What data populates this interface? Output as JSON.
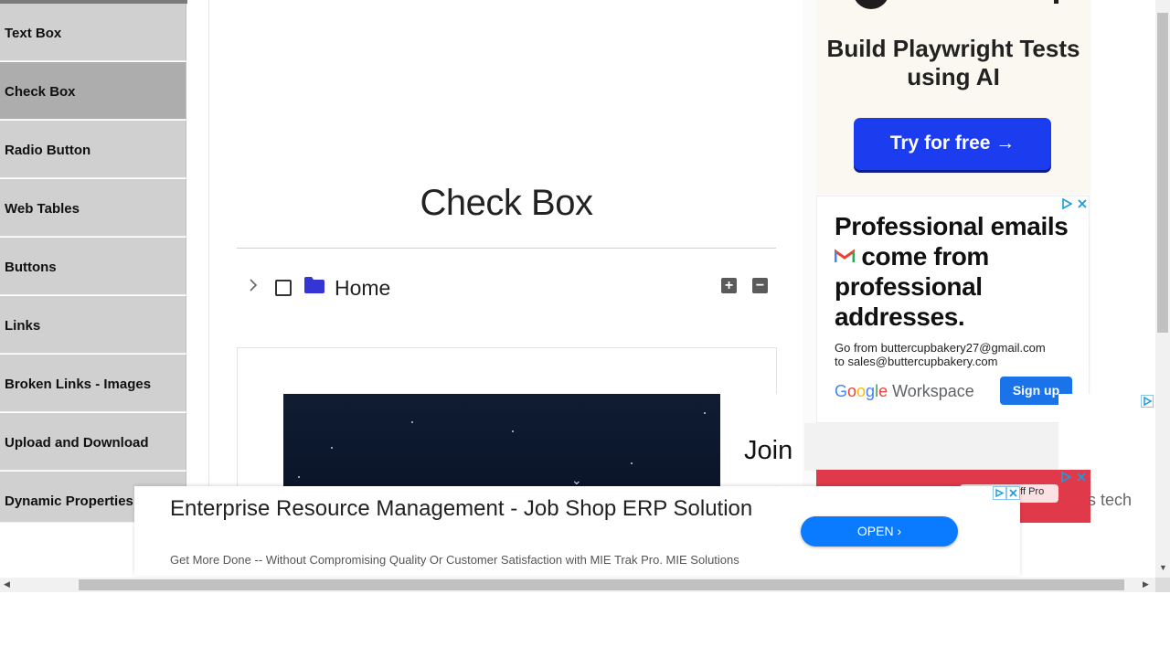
{
  "sidebar": {
    "items": [
      {
        "label": "Text Box",
        "active": false
      },
      {
        "label": "Check Box",
        "active": true
      },
      {
        "label": "Radio Button",
        "active": false
      },
      {
        "label": "Web Tables",
        "active": false
      },
      {
        "label": "Buttons",
        "active": false
      },
      {
        "label": "Links",
        "active": false
      },
      {
        "label": "Broken Links - Images",
        "active": false
      },
      {
        "label": "Upload and Download",
        "active": false
      },
      {
        "label": "Dynamic Properties",
        "active": false
      }
    ]
  },
  "main": {
    "title": "Check Box",
    "tree": {
      "root_label": "Home",
      "checked": false,
      "expanded": false,
      "expand_all_symbol": "+",
      "collapse_all_symbol": "−"
    },
    "video_ad": {
      "side_text": "Join"
    }
  },
  "ads": {
    "playwright": {
      "title": "Build Playwright Tests using AI",
      "cta": "Try for free →"
    },
    "workspace": {
      "headline_part1": "Professional emails",
      "headline_part2": " come from professional addresses.",
      "sub_line1": "Go from buttercupbakery27@gmail.com",
      "sub_line2": "to sales@buttercupbakery.com",
      "brand_g": [
        "G",
        "o",
        "o",
        "g",
        "l",
        "e"
      ],
      "brand_rest": " Workspace",
      "cta": "Sign up"
    },
    "partial_tag": "off Pro",
    "partial_text": "s tech"
  },
  "banner": {
    "title": "Enterprise Resource Management - Job Shop ERP Solution",
    "description": "Get More Done -- Without Compromising Quality Or Customer Satisfaction with MIE Trak Pro. MIE Solutions",
    "cta": "OPEN"
  },
  "colors": {
    "nav_bg": "#d0d0d0",
    "nav_active_bg": "#adadad",
    "folder": "#3535d6",
    "ad_cta_blue": "#1c3cf0",
    "open_button": "#0a7bff"
  }
}
